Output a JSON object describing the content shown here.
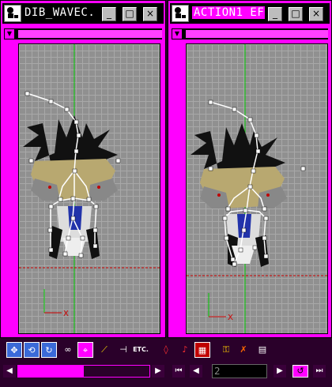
{
  "windows": [
    {
      "title": "DIB_WAVEC...",
      "minimize": "_",
      "maximize": "□",
      "close": "×"
    },
    {
      "title": "ACTION1 EF...",
      "minimize": "_",
      "maximize": "□",
      "close": "×"
    }
  ],
  "viewport": {
    "axis_x_label": "X",
    "grid_color": "#a8a8a8",
    "background_color": "#909090",
    "axis_color": "#00cc00",
    "ground_line_color": "#cc0000"
  },
  "toolbar": {
    "tools": [
      "move-icon",
      "rotate-icon",
      "refresh-icon",
      "link-icon",
      "select-bone-icon",
      "bone-chain-icon",
      "joint-icon",
      "etc-icon",
      "marker-icon",
      "music-note-icon",
      "grid-icon",
      "key-icon",
      "no-key-icon",
      "panel-icon"
    ],
    "etc_label": "ETC."
  },
  "timeline": {
    "scroll_progress": 0.5,
    "frame_value": "2"
  },
  "colors": {
    "accent": "#ff00ff",
    "titlebar": "#000000",
    "panel_bg": "#2a002a"
  }
}
